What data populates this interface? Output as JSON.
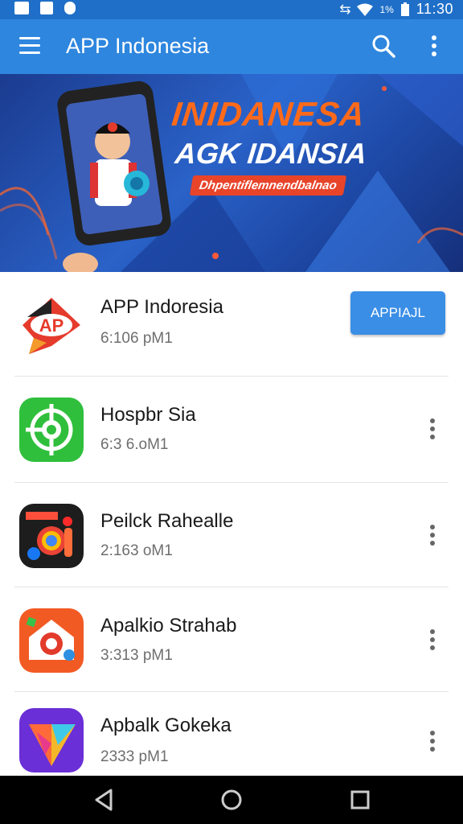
{
  "status_bar": {
    "time": "11:30",
    "signal_text": "1%"
  },
  "app_bar": {
    "title": "APP Indonesia"
  },
  "banner": {
    "headline_1": "INIDANESA",
    "headline_2": "AGK IDANSIA",
    "tagline": "Dhpentiflemnendbalnao"
  },
  "apps": [
    {
      "name": "APP Indoresia",
      "size": "6:106 pM1",
      "action": "APPIAJL",
      "icon": "ap-logo-icon",
      "color": "#e53b2c"
    },
    {
      "name": "Hospbr Sia",
      "size": "6:3 6.oM1",
      "icon": "target-icon",
      "color": "#2fbf3c"
    },
    {
      "name": "Peilck Rahealle",
      "size": "2:163 oM1",
      "icon": "media-collage-icon",
      "color": "#1d1d1d"
    },
    {
      "name": "Apalkio Strahab",
      "size": "3:313 pM1",
      "icon": "camera-home-icon",
      "color": "#f25a24"
    },
    {
      "name": "Apbalk Gokeka",
      "size": "2333 pM1",
      "icon": "prism-triangle-icon",
      "color": "#6a2fd6"
    }
  ],
  "colors": {
    "app_bar": "#2e86de",
    "status_bar": "#1f6fc8",
    "accent_button": "#3a8ee6"
  }
}
